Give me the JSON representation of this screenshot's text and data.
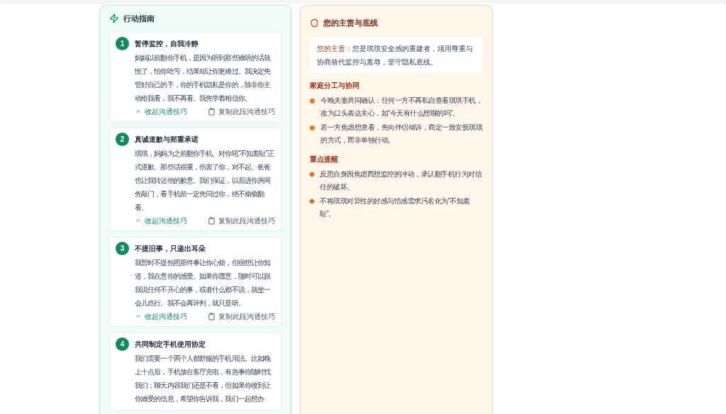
{
  "guide": {
    "title": "行动指南",
    "steps": [
      {
        "number": "1",
        "title": "暂停监控，自我冷静",
        "text": "妈妈以前翻你手机，是因为听到那些难听的话就慌了，怕你吃亏，结果却让你更难过。我决定先管好自己的手，你的手机隐私是你的，除非你主动给我看，我不再看。我先学着相信你。",
        "expanded": true,
        "toggle": "收起沟通技巧",
        "copy": "复制此段沟通技巧"
      },
      {
        "number": "2",
        "title": "真诚道歉与郑重承诺",
        "text": "琪琪，妈妈为之前翻你手机、对你吼“不知羞耻”正式道歉。那些话很重，伤害了你，对不起。爸爸也让我转达他的歉意。我们保证，以后进你房间先敲门，看手机前一定先问过你，绝不偷偷翻看。",
        "expanded": true,
        "toggle": "收起沟通技巧",
        "copy": "复制此段沟通技巧"
      },
      {
        "number": "3",
        "title": "不提旧事，只递出耳朵",
        "text": "我暂时不提拍照那件事让你心烦，但很想让你知道，我在意你的感受。如果你愿意，随时可以跟我说任何不开心的事，或者什么都不说，就坐一会儿也行。我不会再评判，就只是听。",
        "expanded": true,
        "toggle": "收起沟通技巧",
        "copy": "复制此段沟通技巧"
      },
      {
        "number": "4",
        "title": "共同制定手机使用协定",
        "text": "我们需要一个两个人都舒服的手机用法。比如晚上十点后，手机放在客厅充电，有急事你随时找我们；聊天内容我们还是不看，但如果你收到让你难受的信息，希望你告诉我，我们一起想办"
      }
    ]
  },
  "duty": {
    "title": "您的主责与底线",
    "summary": "**您的主责**：您是琪琪安全感的重建者，须用尊重与协商替代监控与羞辱，坚守隐私底线。",
    "sections": [
      {
        "heading": "家庭分工与协同",
        "kind": "dot",
        "items": [
          "今晚夫妻共同确认：任何一方不再私自查看琪琪手机，改为口头表达关心，如“今天有什么想聊的吗”。",
          "若一方焦虑想查看，先向伴侣倾诉，商定一致安抚琪琪的方式，而非单独行动。"
        ]
      },
      {
        "heading": "重点提醒",
        "kind": "diamond",
        "items": [
          "反思自身因焦虑而想监控的冲动，承认翻手机行为对信任的破坏。",
          "不将琪琪对异性的好感与情感需求污名化为“不知羞耻”。"
        ]
      }
    ]
  }
}
